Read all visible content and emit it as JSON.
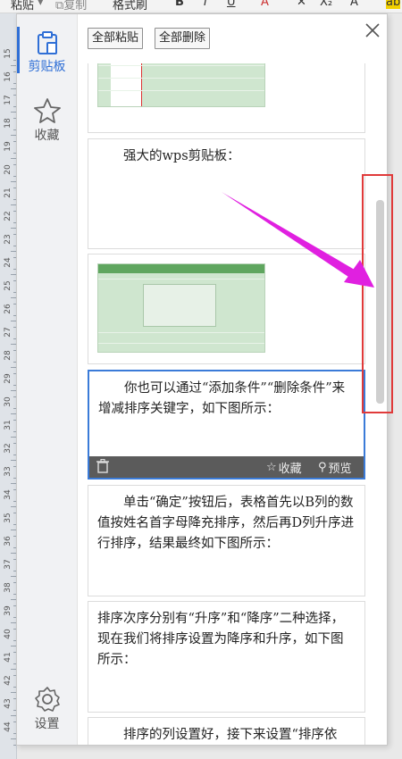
{
  "toolbar": {
    "paste_label": "粘贴",
    "copy_label": "复制",
    "format_painter_label": "格式刷"
  },
  "ruler": {
    "numbers": [
      "15",
      "16",
      "17",
      "18",
      "19",
      "20",
      "21",
      "22",
      "23",
      "24",
      "25",
      "26",
      "27",
      "28",
      "29",
      "30",
      "31",
      "32",
      "33",
      "34",
      "35",
      "36",
      "37",
      "38",
      "39",
      "40",
      "41",
      "42",
      "43",
      "44"
    ]
  },
  "sidebar": {
    "clipboard_label": "剪贴板",
    "favorites_label": "收藏",
    "settings_label": "设置"
  },
  "actions": {
    "paste_all": "全部粘贴",
    "delete_all": "全部删除"
  },
  "cards": [
    {
      "kind": "image"
    },
    {
      "kind": "text",
      "text": "　　强大的wps剪贴板："
    },
    {
      "kind": "image"
    },
    {
      "kind": "text",
      "text": "　　你也可以通过“添加条件”“删除条件”来增减排序关键字，如下图所示："
    },
    {
      "kind": "text",
      "text": "　　单击“确定”按钮后，表格首先以B列的数值按姓名首字母降充排序，然后再D列升序进行排序，结果最终如下图所示："
    },
    {
      "kind": "text",
      "text": "排序次序分别有“升序”和“降序”二种选择，现在我们将排序设置为降序和升序，如下图所示："
    },
    {
      "kind": "text",
      "text": "　　排序的列设置好，接下来设置“排序依据”，排序依据中有四个"
    }
  ],
  "card_actions": {
    "favorite_label": "收藏",
    "preview_label": "预览"
  },
  "colors": {
    "accent": "#2f6fd6",
    "annotation_arrow": "#e020e0",
    "annotation_box": "#e03a3a"
  }
}
